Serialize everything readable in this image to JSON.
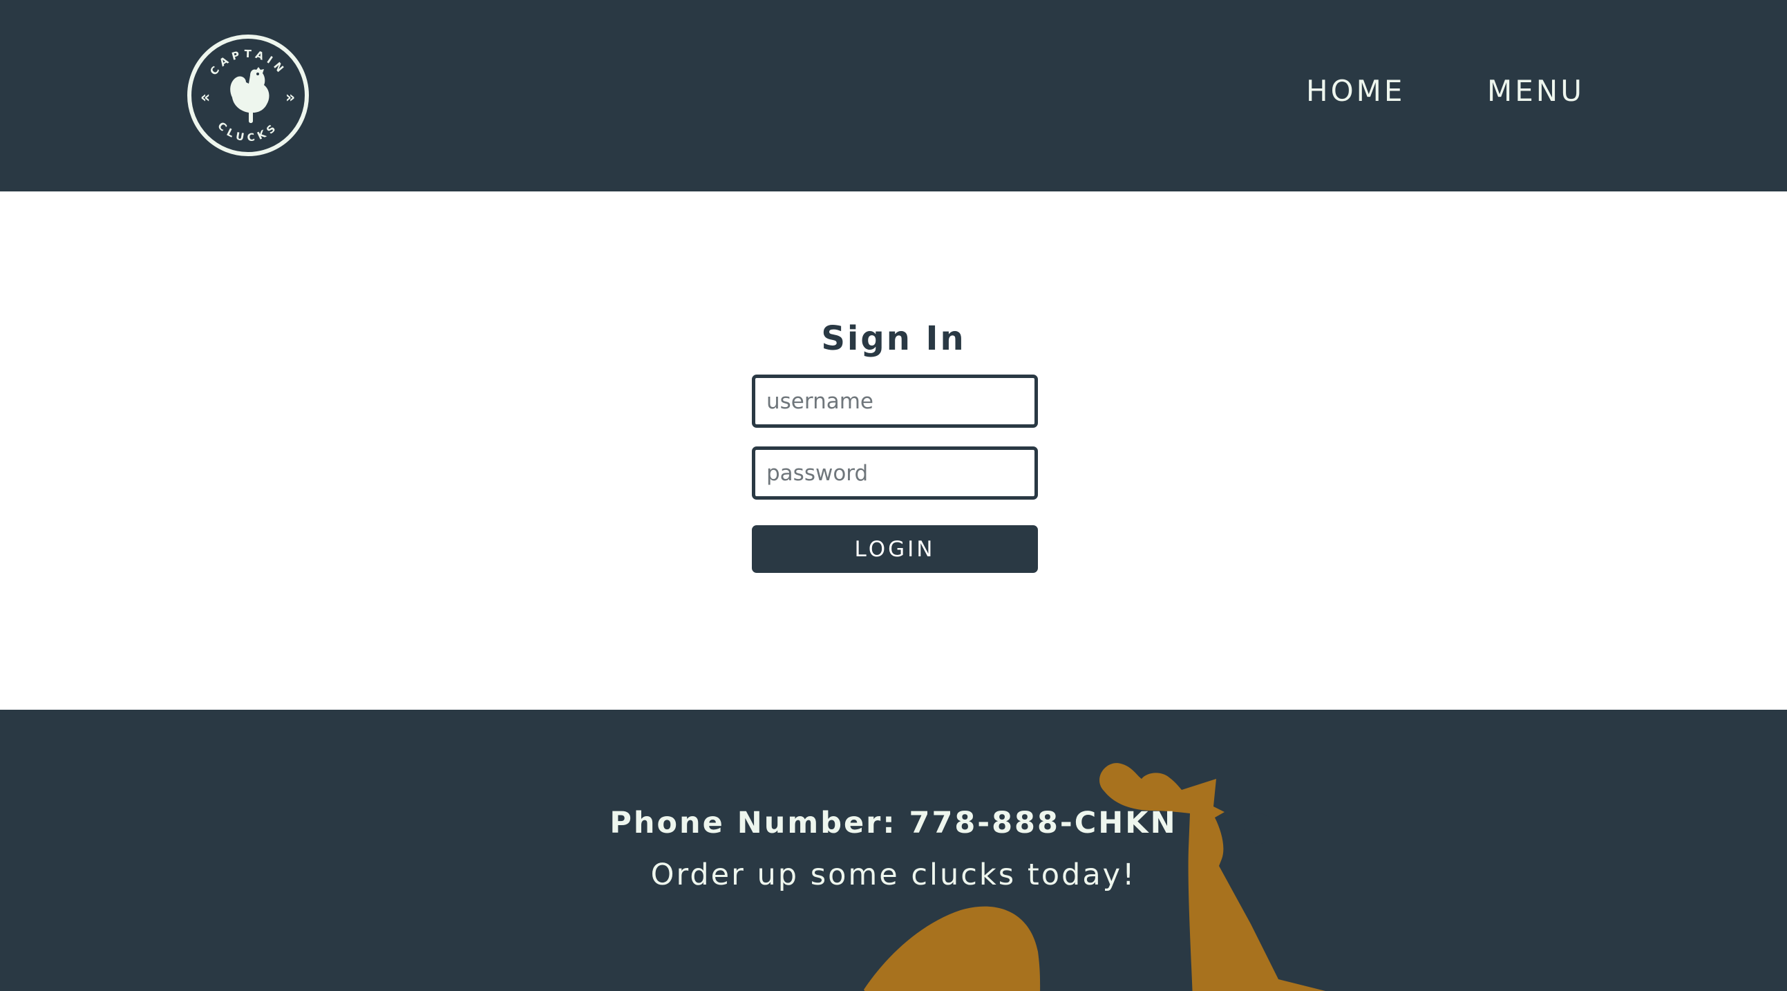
{
  "header": {
    "logo": {
      "icon": "captain-clucks-logo",
      "text_top": "CAPTAIN",
      "text_bottom": "CLUCKS"
    },
    "nav": {
      "home_label": "HOME",
      "menu_label": "MENU"
    }
  },
  "signin": {
    "title": "Sign In",
    "username_placeholder": "username",
    "username_value": "",
    "password_placeholder": "password",
    "password_value": "",
    "login_label": "LOGIN"
  },
  "footer": {
    "phone": "Phone Number: 778-888-CHKN",
    "tagline": "Order up some clucks today!",
    "decoration_icon": "rooster-icon"
  },
  "colors": {
    "navy": "#2a3944",
    "cream": "#eef6ee",
    "gold": "#a8721e",
    "white": "#ffffff"
  }
}
